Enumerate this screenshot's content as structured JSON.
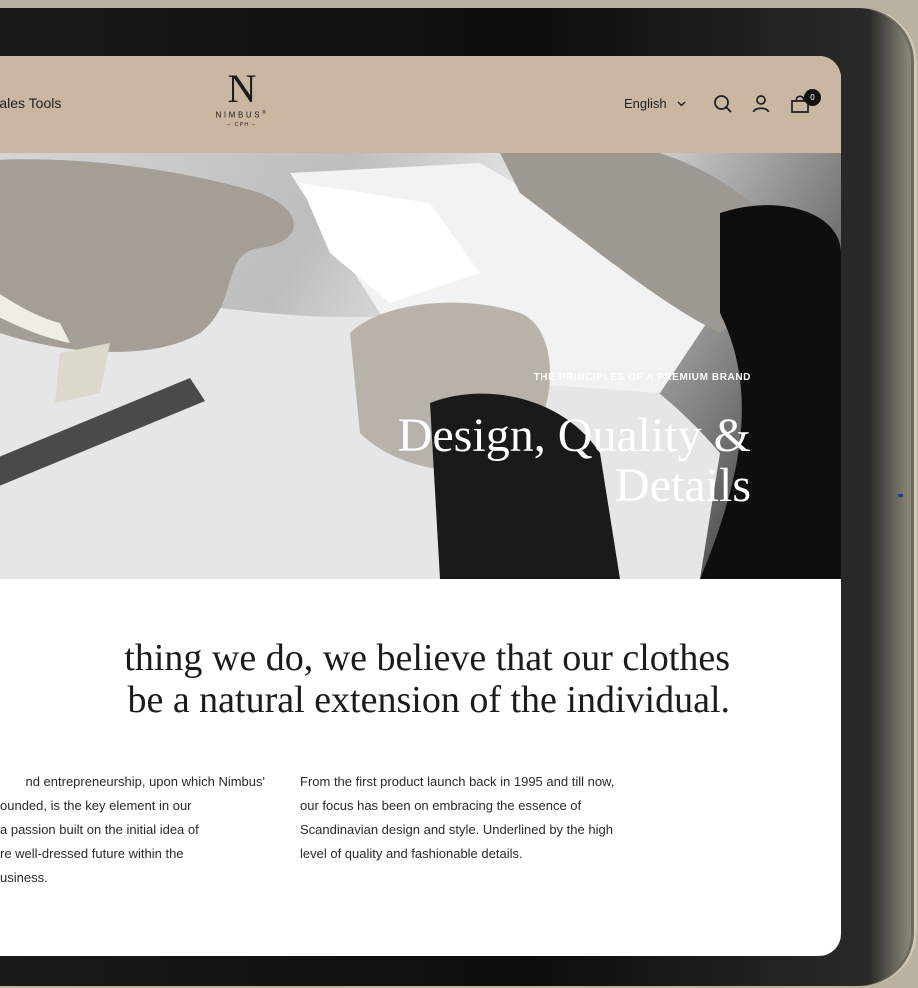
{
  "header": {
    "nav_link": "Sales Tools",
    "logo": {
      "mark": "N",
      "wordmark": "NIMBUS",
      "registered": "®",
      "sub": "– CPH –"
    },
    "language": "English",
    "cart_count": "0",
    "icons": [
      "chevron-down-icon",
      "search-icon",
      "account-icon",
      "cart-icon"
    ]
  },
  "hero": {
    "eyebrow": "THE PRINCIPLES OF A PREMIUM BRAND",
    "title_line1": "Design, Quality &",
    "title_line2": "Details"
  },
  "content": {
    "statement_line1": "thing we do, we believe that our clothes",
    "statement_line2": "be a natural extension of the individual.",
    "col1": [
      "nd entrepreneurship, upon which Nimbus'",
      "ounded, is the key element in our",
      "a passion built on the initial idea of",
      "re well-dressed future within the",
      "usiness."
    ],
    "col2": [
      "From the first product launch back in 1995 and till now,",
      "our focus has been on embracing the essence of",
      "Scandinavian design and style. Underlined by the high",
      "level of quality and fashionable details."
    ]
  },
  "colors": {
    "header_bg": "#c9b7a2",
    "frame": "#0d0d0d",
    "background": "#b9b29f"
  }
}
